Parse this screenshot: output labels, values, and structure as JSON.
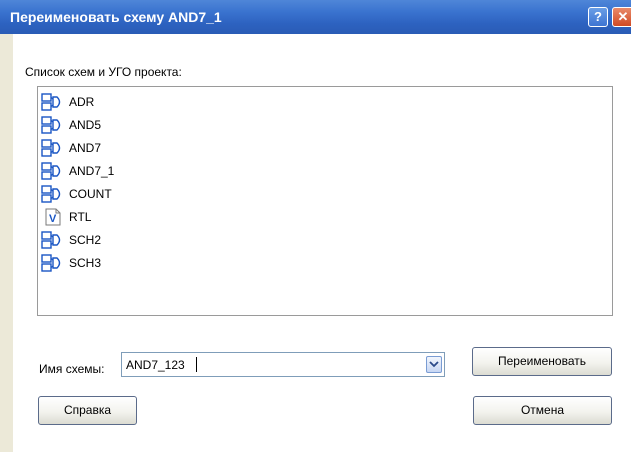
{
  "window": {
    "title": "Переименовать схему AND7_1",
    "help_glyph": "?",
    "close_glyph": "✕"
  },
  "list": {
    "label": "Список схем и УГО проекта:",
    "items": [
      {
        "label": "ADR",
        "icon": "schematic-icon"
      },
      {
        "label": "AND5",
        "icon": "schematic-icon"
      },
      {
        "label": "AND7",
        "icon": "schematic-icon"
      },
      {
        "label": "AND7_1",
        "icon": "schematic-icon"
      },
      {
        "label": "COUNT",
        "icon": "schematic-icon"
      },
      {
        "label": "RTL",
        "icon": "verilog-file-icon",
        "icon_letter": "V"
      },
      {
        "label": "SCH2",
        "icon": "schematic-icon"
      },
      {
        "label": "SCH3",
        "icon": "schematic-icon"
      }
    ]
  },
  "name_field": {
    "label": "Имя схемы:",
    "value": "AND7_123"
  },
  "buttons": {
    "rename": "Переименовать",
    "help": "Справка",
    "cancel": "Отмена"
  },
  "colors": {
    "titlebar": "#2d62c0",
    "icon_blue": "#1a56c4",
    "border": "#9a9a9a"
  }
}
